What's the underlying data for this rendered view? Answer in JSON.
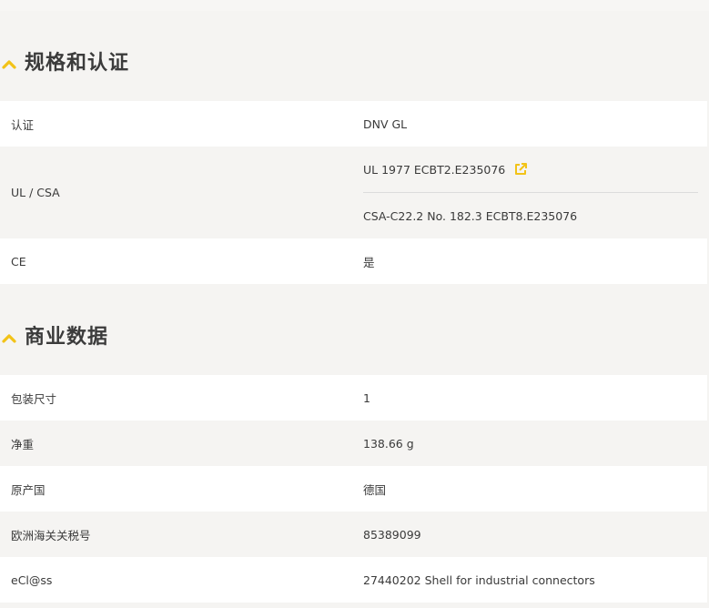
{
  "colors": {
    "accent": "#f2c318",
    "white_row": "#ffffff",
    "grey_row": "#f5f4f2",
    "text": "#3a3a3a"
  },
  "certifications": {
    "title": "规格和认证",
    "collapse_icon": "chevron-up-icon",
    "rows": [
      {
        "label": "认证",
        "value": "DNV GL"
      },
      {
        "label": "UL / CSA",
        "values": [
          "UL 1977 ECBT2.E235076",
          "CSA-C22.2 No. 182.3 ECBT8.E235076"
        ],
        "link_icon": "external-link-icon"
      },
      {
        "label": "CE",
        "value": "是"
      }
    ]
  },
  "commercial": {
    "title": "商业数据",
    "collapse_icon": "chevron-up-icon",
    "rows": [
      {
        "label": "包装尺寸",
        "value": "1"
      },
      {
        "label": "净重",
        "value": "138.66 g"
      },
      {
        "label": "原产国",
        "value": "德国"
      },
      {
        "label": "欧洲海关关税号",
        "value": "85389099"
      },
      {
        "label": "eCl@ss",
        "value": "27440202 Shell for industrial connectors"
      }
    ]
  }
}
